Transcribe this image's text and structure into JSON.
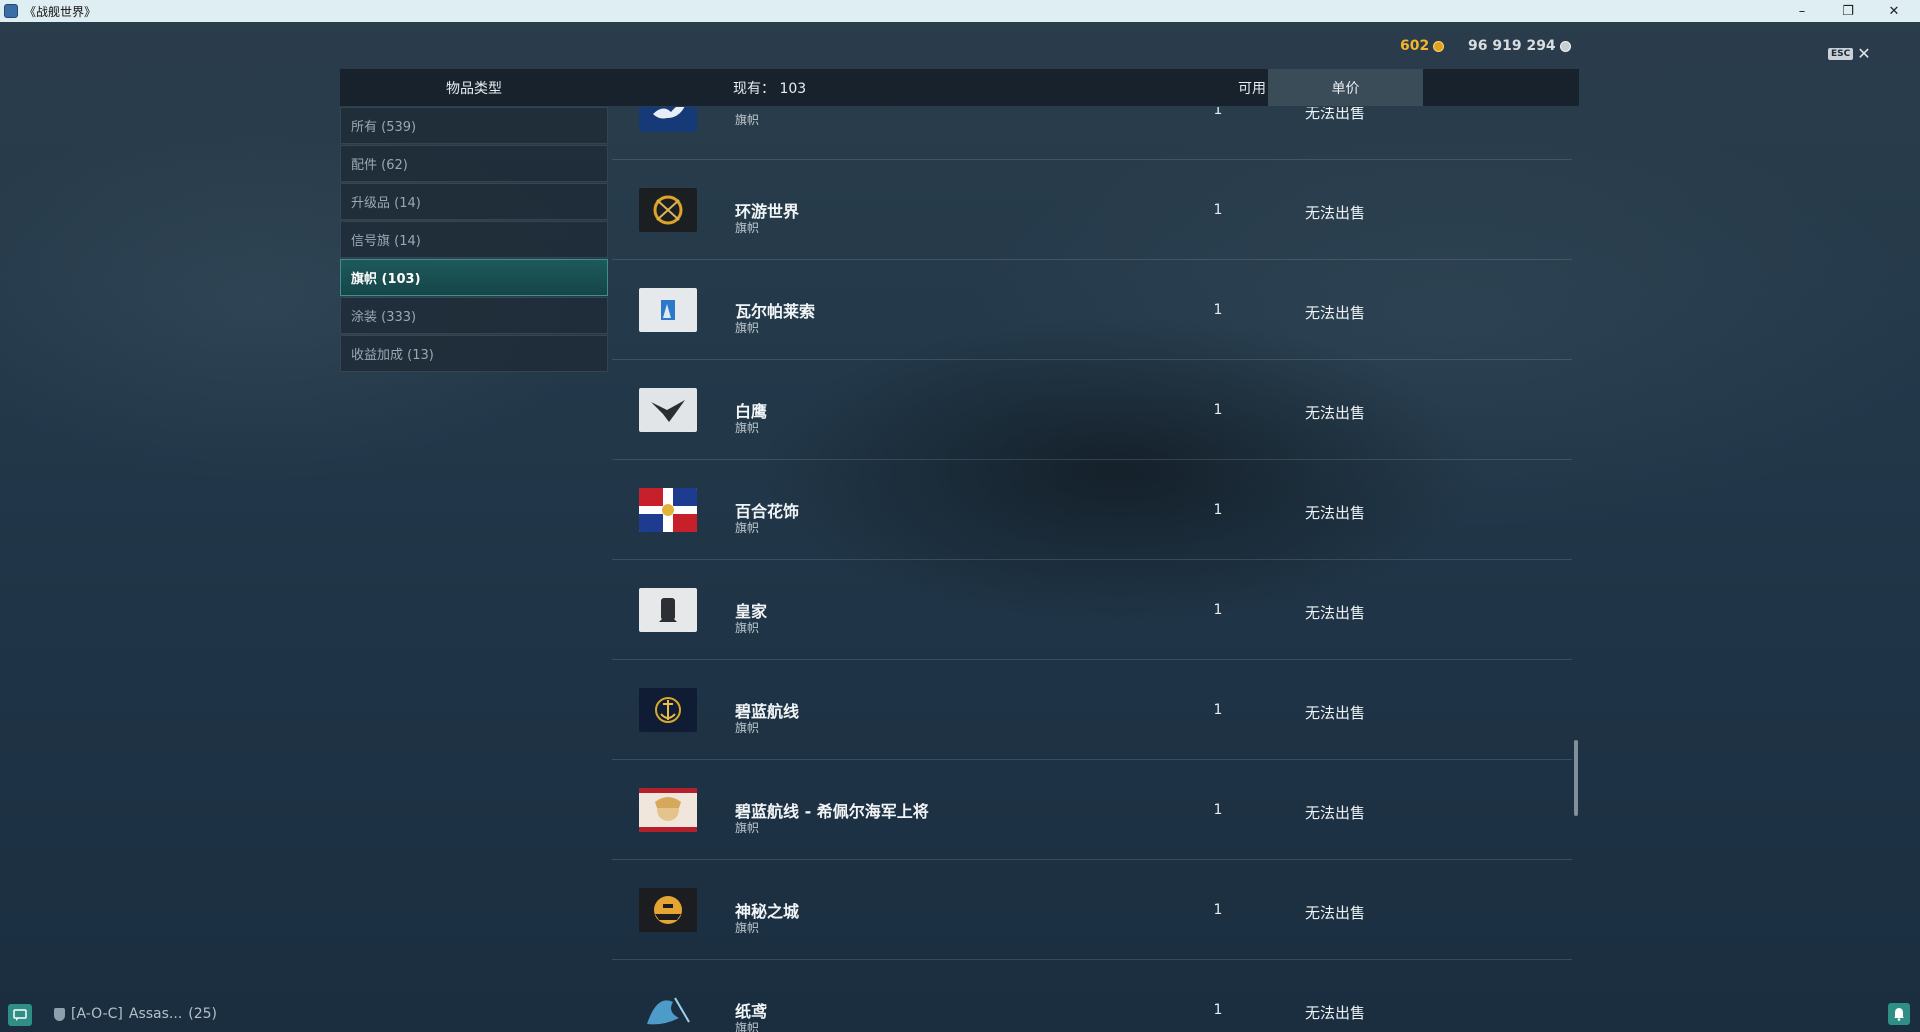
{
  "window": {
    "title": "《战舰世界》"
  },
  "currency": {
    "gold": "602",
    "credits": "96 919 294",
    "gold_color": "#f3b52b",
    "credits_color": "#d8dde0"
  },
  "esc": {
    "key": "ESC",
    "close": "✕"
  },
  "header": {
    "item_type": "物品类型",
    "owned": "现有：  103",
    "available": "可用",
    "unit_price": "单价"
  },
  "sidebar": {
    "items": [
      {
        "label": "所有 (539)"
      },
      {
        "label": "配件 (62)"
      },
      {
        "label": "升级品 (14)"
      },
      {
        "label": "信号旗 (14)"
      },
      {
        "label": "旗帜 (103)",
        "active": true
      },
      {
        "label": "涂装 (333)"
      },
      {
        "label": "收益加成 (13)"
      }
    ]
  },
  "rows": [
    {
      "name": "",
      "type": "旗帜",
      "count": "1",
      "price": "无法出售",
      "icon": "dove-flag-icon"
    },
    {
      "name": "环游世界",
      "type": "旗帜",
      "count": "1",
      "price": "无法出售",
      "icon": "compass-flag-icon"
    },
    {
      "name": "瓦尔帕莱索",
      "type": "旗帜",
      "count": "1",
      "price": "无法出售",
      "icon": "valparaiso-flag-icon"
    },
    {
      "name": "白鹰",
      "type": "旗帜",
      "count": "1",
      "price": "无法出售",
      "icon": "eagle-flag-icon"
    },
    {
      "name": "百合花饰",
      "type": "旗帜",
      "count": "1",
      "price": "无法出售",
      "icon": "fleur-de-lis-flag-icon"
    },
    {
      "name": "皇家",
      "type": "旗帜",
      "count": "1",
      "price": "无法出售",
      "icon": "royal-flag-icon"
    },
    {
      "name": "碧蓝航线",
      "type": "旗帜",
      "count": "1",
      "price": "无法出售",
      "icon": "anchor-flag-icon"
    },
    {
      "name": "碧蓝航线 - 希佩尔海军上将",
      "type": "旗帜",
      "count": "1",
      "price": "无法出售",
      "icon": "anime-character-flag-icon"
    },
    {
      "name": "神秘之城",
      "type": "旗帜",
      "count": "1",
      "price": "无法出售",
      "icon": "mystery-city-flag-icon"
    },
    {
      "name": "纸鸢",
      "type": "旗帜",
      "count": "1",
      "price": "无法出售",
      "icon": "kite-flag-icon"
    }
  ],
  "bottom": {
    "clan": "[A-O-C]",
    "player": "Assas...",
    "count": "(25)"
  }
}
